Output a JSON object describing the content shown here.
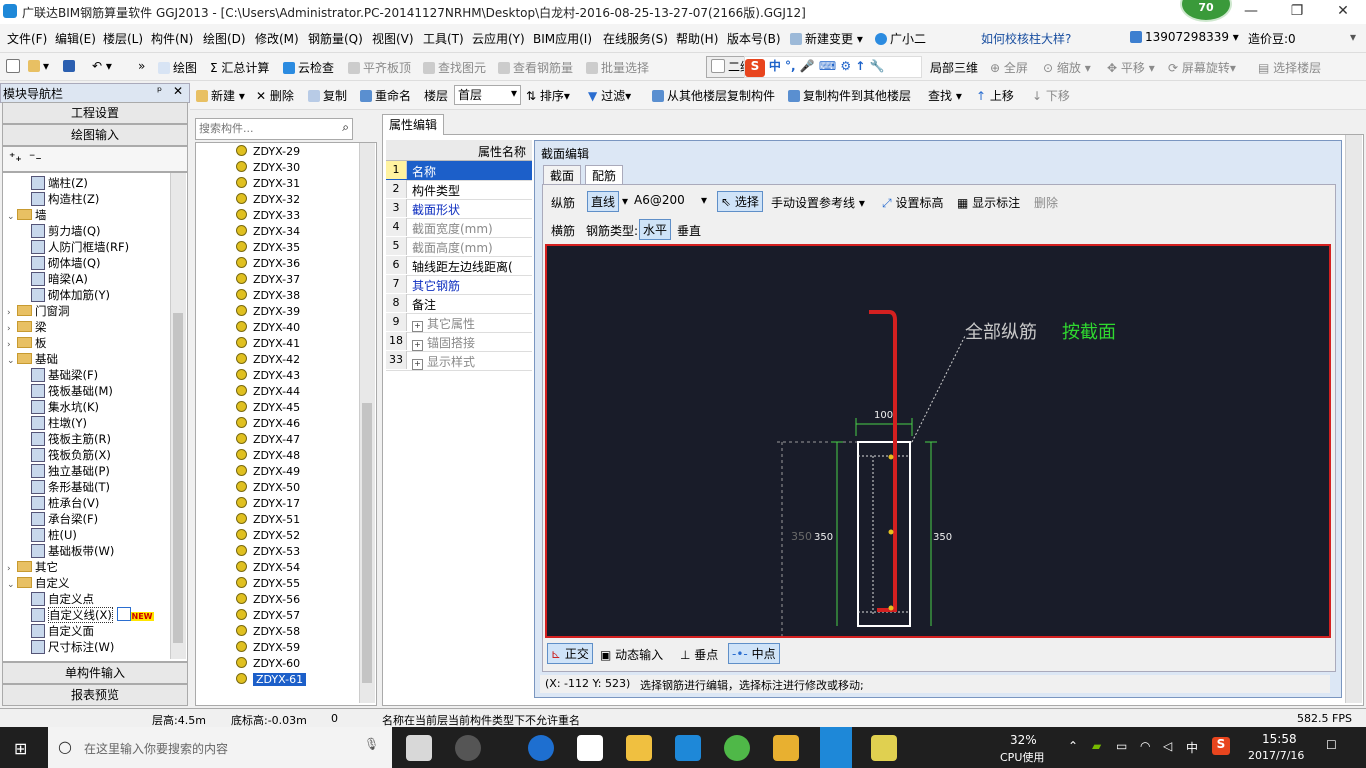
{
  "window": {
    "title": "广联达BIM钢筋算量软件 GGJ2013 - [C:\\Users\\Administrator.PC-20141127NRHM\\Desktop\\白龙村-2016-08-25-13-27-07(2166版).GGJ12]",
    "badge": "70",
    "min": "—",
    "max": "❐",
    "close": "✕"
  },
  "menu": [
    "文件(F)",
    "编辑(E)",
    "楼层(L)",
    "构件(N)",
    "绘图(D)",
    "修改(M)",
    "钢筋量(Q)",
    "视图(V)",
    "工具(T)",
    "云应用(Y)",
    "BIM应用(I)",
    "在线服务(S)",
    "帮助(H)",
    "版本号(B)",
    "新建变更",
    "广小二"
  ],
  "menu_right": {
    "help_link": "如何校核柱大样?",
    "phone": "13907298339",
    "price": "造价豆:0"
  },
  "toolbar": {
    "draw": "绘图",
    "sum": "汇总计算",
    "cloud_check": "云检查",
    "flush": "平齐板顶",
    "find_elem": "查找图元",
    "view_rebar": "查看钢筋量",
    "batch_select": "批量选择",
    "two_d": "二维",
    "partial3d": "局部三维",
    "fullscreen": "全屏",
    "zoom": "缩放",
    "pan": "平移",
    "rotate": "屏幕旋转",
    "select_floor": "选择楼层"
  },
  "toolbar2": {
    "new": "新建",
    "delete": "删除",
    "copy": "复制",
    "rename": "重命名",
    "floor_label": "楼层",
    "floor_value": "首层",
    "sort": "排序",
    "filter": "过滤",
    "copy_from": "从其他楼层复制构件",
    "copy_to": "复制构件到其他楼层",
    "find": "查找",
    "up": "上移",
    "down": "下移"
  },
  "nav": {
    "header": "模块导航栏",
    "pin": "ᵖ",
    "close": "✕",
    "btn_project": "工程设置",
    "btn_draw": "绘图输入",
    "btn_single": "单构件输入",
    "btn_report": "报表预览",
    "tree": [
      {
        "label": "端柱(Z)",
        "indent": 2,
        "type": "item"
      },
      {
        "label": "构造柱(Z)",
        "indent": 2,
        "type": "item"
      },
      {
        "label": "墙",
        "indent": 1,
        "type": "folder",
        "exp": "⌄"
      },
      {
        "label": "剪力墙(Q)",
        "indent": 2,
        "type": "item"
      },
      {
        "label": "人防门框墙(RF)",
        "indent": 2,
        "type": "item"
      },
      {
        "label": "砌体墙(Q)",
        "indent": 2,
        "type": "item"
      },
      {
        "label": "暗梁(A)",
        "indent": 2,
        "type": "item"
      },
      {
        "label": "砌体加筋(Y)",
        "indent": 2,
        "type": "item"
      },
      {
        "label": "门窗洞",
        "indent": 1,
        "type": "folder",
        "exp": "›"
      },
      {
        "label": "梁",
        "indent": 1,
        "type": "folder",
        "exp": "›"
      },
      {
        "label": "板",
        "indent": 1,
        "type": "folder",
        "exp": "›"
      },
      {
        "label": "基础",
        "indent": 1,
        "type": "folder",
        "exp": "⌄"
      },
      {
        "label": "基础梁(F)",
        "indent": 2,
        "type": "item"
      },
      {
        "label": "筏板基础(M)",
        "indent": 2,
        "type": "item"
      },
      {
        "label": "集水坑(K)",
        "indent": 2,
        "type": "item"
      },
      {
        "label": "柱墩(Y)",
        "indent": 2,
        "type": "item"
      },
      {
        "label": "筏板主筋(R)",
        "indent": 2,
        "type": "item"
      },
      {
        "label": "筏板负筋(X)",
        "indent": 2,
        "type": "item"
      },
      {
        "label": "独立基础(P)",
        "indent": 2,
        "type": "item"
      },
      {
        "label": "条形基础(T)",
        "indent": 2,
        "type": "item"
      },
      {
        "label": "桩承台(V)",
        "indent": 2,
        "type": "item"
      },
      {
        "label": "承台梁(F)",
        "indent": 2,
        "type": "item"
      },
      {
        "label": "桩(U)",
        "indent": 2,
        "type": "item"
      },
      {
        "label": "基础板带(W)",
        "indent": 2,
        "type": "item"
      },
      {
        "label": "其它",
        "indent": 1,
        "type": "folder",
        "exp": "›"
      },
      {
        "label": "自定义",
        "indent": 1,
        "type": "folder",
        "exp": "⌄"
      },
      {
        "label": "自定义点",
        "indent": 2,
        "type": "item"
      },
      {
        "label": "自定义线(X)",
        "indent": 2,
        "type": "item",
        "selected": true
      },
      {
        "label": "自定义面",
        "indent": 2,
        "type": "item"
      },
      {
        "label": "尺寸标注(W)",
        "indent": 2,
        "type": "item"
      }
    ],
    "new_badge": "NEW"
  },
  "search": {
    "placeholder": "搜索构件..."
  },
  "components": [
    "ZDYX-29",
    "ZDYX-30",
    "ZDYX-31",
    "ZDYX-32",
    "ZDYX-33",
    "ZDYX-34",
    "ZDYX-35",
    "ZDYX-36",
    "ZDYX-37",
    "ZDYX-38",
    "ZDYX-39",
    "ZDYX-40",
    "ZDYX-41",
    "ZDYX-42",
    "ZDYX-43",
    "ZDYX-44",
    "ZDYX-45",
    "ZDYX-46",
    "ZDYX-47",
    "ZDYX-48",
    "ZDYX-49",
    "ZDYX-50",
    "ZDYX-17",
    "ZDYX-51",
    "ZDYX-52",
    "ZDYX-53",
    "ZDYX-54",
    "ZDYX-55",
    "ZDYX-56",
    "ZDYX-57",
    "ZDYX-58",
    "ZDYX-59",
    "ZDYX-60",
    "ZDYX-61"
  ],
  "props": {
    "tab": "属性编辑",
    "header": "属性名称",
    "rows": [
      {
        "n": "1",
        "label": "名称",
        "color": "blue",
        "selected": true
      },
      {
        "n": "2",
        "label": "构件类型",
        "color": "black"
      },
      {
        "n": "3",
        "label": "截面形状",
        "color": "blue"
      },
      {
        "n": "4",
        "label": "截面宽度(mm)",
        "color": "gray"
      },
      {
        "n": "5",
        "label": "截面高度(mm)",
        "color": "gray"
      },
      {
        "n": "6",
        "label": "轴线距左边线距离(",
        "color": "black"
      },
      {
        "n": "7",
        "label": "其它钢筋",
        "color": "blue"
      },
      {
        "n": "8",
        "label": "备注",
        "color": "black"
      },
      {
        "n": "9",
        "label": "其它属性",
        "color": "gray",
        "plus": true
      },
      {
        "n": "18",
        "label": "锚固搭接",
        "color": "gray",
        "plus": true
      },
      {
        "n": "33",
        "label": "显示样式",
        "color": "gray",
        "plus": true
      }
    ]
  },
  "dialog": {
    "title": "截面编辑",
    "tab_section": "截面",
    "tab_rebar": "配筋",
    "long_rebar": "纵筋",
    "straight": "直线",
    "spec": "A6@200",
    "select": "选择",
    "manual_ref": "手动设置参考线",
    "set_elev": "设置标高",
    "show_dim": "显示标注",
    "delete": "删除",
    "transverse": "横筋",
    "rebar_type": "钢筋类型:",
    "horizontal": "水平",
    "vertical": "垂直",
    "canvas": {
      "label_all": "全部纵筋",
      "label_section": "按截面",
      "dim_top": "100",
      "dim_left_outer": "350",
      "dim_left": "350",
      "dim_right": "350"
    },
    "bottom": {
      "ortho": "正交",
      "dynamic": "动态输入",
      "perp": "垂点",
      "mid": "中点"
    },
    "coords": "(X: -112 Y: 523)",
    "hint": "选择钢筋进行编辑，选择标注进行修改或移动;"
  },
  "status": {
    "floor_h": "层高:4.5m",
    "bottom_elev": "底标高:-0.03m",
    "zero": "0",
    "msg": "名称在当前层当前构件类型下不允许重名",
    "fps": "582.5 FPS"
  },
  "taskbar": {
    "search": "在这里输入你要搜索的内容",
    "cpu_pct": "32%",
    "cpu_label": "CPU使用",
    "ime": "中",
    "time": "15:58",
    "date": "2017/7/16"
  },
  "colors": {
    "accent": "#1e88d8",
    "canvas_bg": "#191c29",
    "rebar_red": "#d42020",
    "label_green": "#2fd82f",
    "dim_green": "#49d049"
  }
}
